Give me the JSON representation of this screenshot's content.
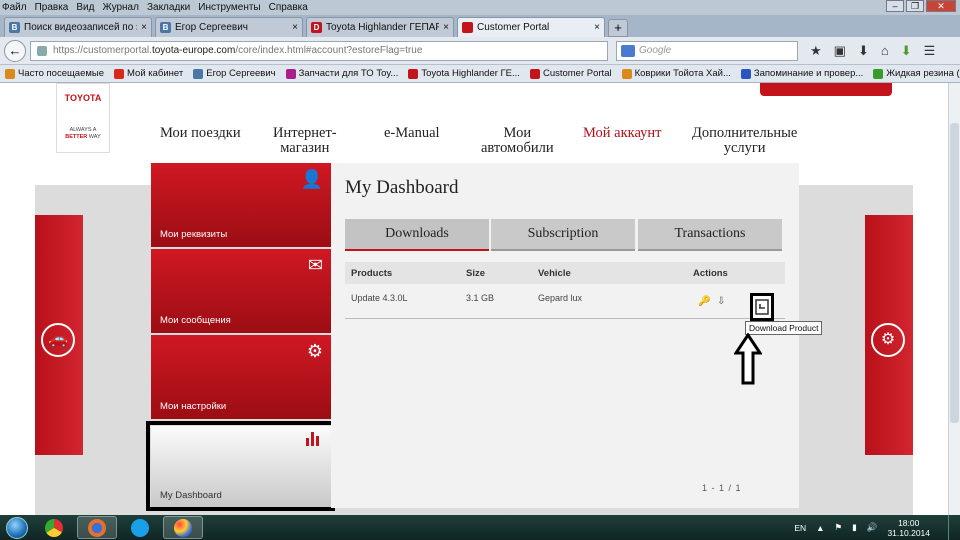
{
  "menu": [
    "Файл",
    "Правка",
    "Вид",
    "Журнал",
    "Закладки",
    "Инструменты",
    "Справка"
  ],
  "tabs": [
    {
      "label": "Поиск видеозаписей по з...",
      "icon": "vk-icon",
      "color": "#4a76a8",
      "glyph": "B"
    },
    {
      "label": "Егор Сергеевич",
      "icon": "vk-icon",
      "color": "#4a76a8",
      "glyph": "B"
    },
    {
      "label": "Toyota Highlander ГЕПАР...",
      "icon": "drive2-icon",
      "color": "#c3141b",
      "glyph": "D"
    },
    {
      "label": "Customer Portal",
      "icon": "toyota-icon",
      "color": "#c3141b",
      "glyph": ""
    }
  ],
  "address": {
    "prefix": "https://customerportal.",
    "host": "toyota-europe.com",
    "path": "/core/index.html#account?estoreFlag=true"
  },
  "search_placeholder": "Google",
  "bookmarks": [
    {
      "label": "Часто посещаемые",
      "color": "#d98a1a"
    },
    {
      "label": "Мой кабинет",
      "color": "#d9281a"
    },
    {
      "label": "Егор Сергеевич",
      "color": "#4a76a8"
    },
    {
      "label": "Запчасти для ТО Toy...",
      "color": "#a8208a"
    },
    {
      "label": "Toyota Highlander ГЕ...",
      "color": "#c3141b"
    },
    {
      "label": "Customer Portal",
      "color": "#c3141b"
    },
    {
      "label": "Коврики Тойота Хай...",
      "color": "#d98a1a"
    },
    {
      "label": "Запоминание и провер...",
      "color": "#2a55c0"
    },
    {
      "label": "Жидкая резина (400м...",
      "color": "#3a9a2a"
    }
  ],
  "logo": {
    "brand": "TOYOTA",
    "tag1": "ALWAYS A",
    "tag2": "BETTER",
    "tag3": "WAY"
  },
  "nav": {
    "trips": "Мои поездки",
    "shop1": "Интернет-",
    "shop2": "магазин",
    "emanual": "e-Manual",
    "cars1": "Мои",
    "cars2": "автомобили",
    "account": "Мой аккаунт",
    "extra1": "Дополнительные",
    "extra2": "услуги"
  },
  "cards": {
    "details": "Мои реквизиты",
    "messages": "Мои сообщения",
    "settings": "Мои настройки",
    "dashboard": "My Dashboard"
  },
  "main": {
    "title": "My Dashboard",
    "tabs": [
      "Downloads",
      "Subscription",
      "Transactions"
    ],
    "columns": [
      "Products",
      "Size",
      "Vehicle",
      "Actions"
    ],
    "rows": [
      {
        "product": "Update 4.3.0L",
        "size": "3.1 GB",
        "vehicle": "Gepard lux"
      }
    ],
    "tooltip": "Download Product",
    "pager": "1 - 1 / 1"
  },
  "taskbar": {
    "lang": "EN",
    "time": "18:00",
    "date": "31.10.2014"
  }
}
